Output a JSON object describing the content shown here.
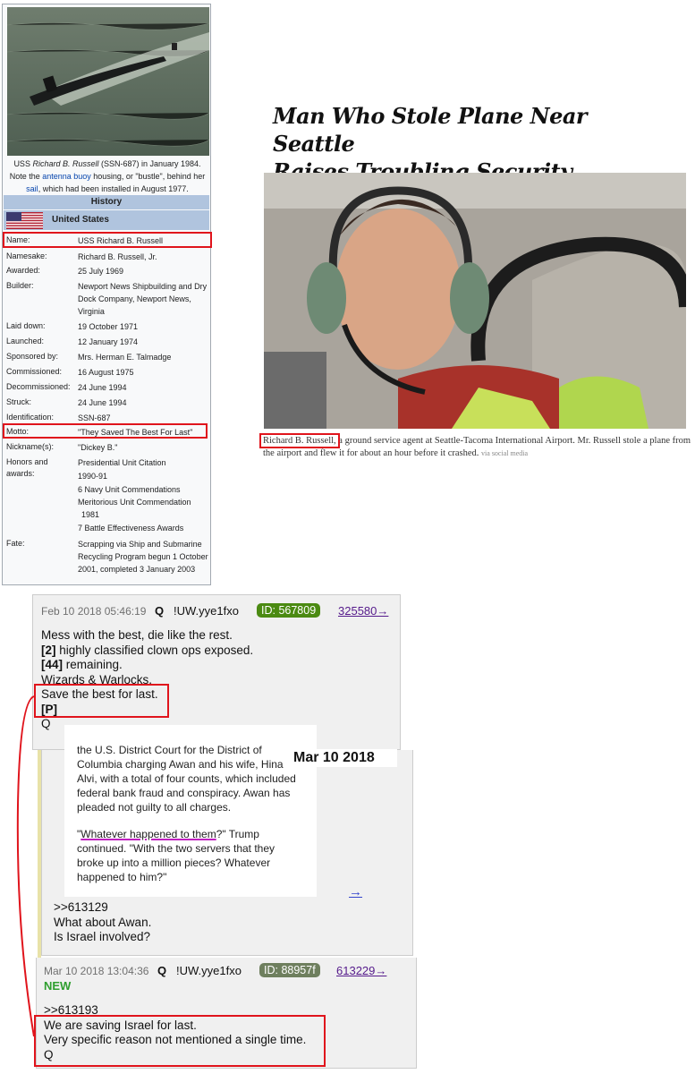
{
  "wiki": {
    "photo_caption_prefix": "USS ",
    "photo_caption_italic": "Richard B. Russell",
    "photo_caption_rest": " (SSN-687) in January 1984.",
    "photo_note_1": "Note the ",
    "photo_note_link1": "antenna buoy",
    "photo_note_2": " housing, or \"bustle\", behind her",
    "photo_note_link2": "sail",
    "photo_note_3": ", which had been installed in August 1977.",
    "history_header": "History",
    "country": "United States",
    "fields": [
      {
        "label": "Name:",
        "value": "USS Richard B. Russell"
      },
      {
        "label": "Namesake:",
        "value": "Richard B. Russell, Jr."
      },
      {
        "label": "Awarded:",
        "value": "25 July 1969"
      },
      {
        "label": "Builder:",
        "value": "Newport News Shipbuilding and Dry Dock Company, Newport News, Virginia"
      },
      {
        "label": "Laid down:",
        "value": "19 October 1971"
      },
      {
        "label": "Launched:",
        "value": "12 January 1974"
      },
      {
        "label": "Sponsored by:",
        "value": "Mrs. Herman E. Talmadge"
      },
      {
        "label": "Commissioned:",
        "value": "16 August 1975"
      },
      {
        "label": "Decommissioned:",
        "value": "24 June 1994"
      },
      {
        "label": "Struck:",
        "value": "24 June 1994"
      },
      {
        "label": "Identification:",
        "value": "SSN-687"
      },
      {
        "label": "Motto:",
        "value": "\"They Saved The Best For Last\""
      },
      {
        "label": "Nickname(s):",
        "value": "\"Dickey B.\""
      },
      {
        "label": "Honors and awards:",
        "value": ""
      },
      {
        "label": "Fate:",
        "value": ""
      }
    ],
    "honors": [
      "Presidential Unit Citation",
      "1990-91",
      "6 Navy Unit Commendations",
      "Meritorious Unit Commendation",
      "1981",
      "7 Battle Effectiveness Awards"
    ],
    "fate": "Scrapping via Ship and Submarine Recycling Program begun 1 October 2001, completed 3 January 2003"
  },
  "nyt": {
    "headline_line1": "Man Who Stole Plane Near Seattle",
    "headline_line2": "Raises Troubling Security Questions",
    "caption_name": "Richard B. Russell",
    "caption_rest": ", a ground service agent at Seattle-Tacoma International Airport. Mr. Russell stole a plane from the airport and flew it for about an hour before it crashed.",
    "caption_credit": "via social media"
  },
  "post1": {
    "date": "Feb 10 2018 05:46:19",
    "name": "Q",
    "trip": "!UW.yye1fxo",
    "id": "ID: 567809",
    "id_color": "#4b8a12",
    "post_no": "325580→",
    "line1": "Mess with the best, die like the rest.",
    "line2_bold": "[2]",
    "line2": " highly classified clown ops exposed.",
    "line3_bold": "[44]",
    "line3": " remaining.",
    "line4": "Wizards & Warlocks.",
    "line5": "Save the best for last.",
    "line6": "[P]",
    "line7": "Q"
  },
  "post2": {
    "date_overlay": "Mar 10 2018",
    "quote_l1": "the U.S. District Court for the District of",
    "quote_l2": "Columbia charging Awan and his wife, Hina",
    "quote_l3": "Alvi, with a total of four counts, which included",
    "quote_l4": "federal bank fraud and conspiracy. Awan has",
    "quote_l5": "pleaded not guilty to all charges.",
    "quote_l6a": "\"",
    "quote_l6u": "Whatever happened to them",
    "quote_l6b": "?\" Trump",
    "quote_l7": "continued. \"With the two servers that they",
    "quote_l8": "broke up into a million pieces? Whatever",
    "quote_l9": "happened to him?\"",
    "arrow": "→",
    "reply_ref": ">>613129",
    "reply_l1": "What about Awan.",
    "reply_l2": "Is Israel involved?"
  },
  "post3": {
    "date": "Mar 10 2018 13:04:36",
    "name": "Q",
    "trip": "!UW.yye1fxo",
    "id": "ID: 88957f",
    "id_color": "#6e7f5e",
    "post_no": "613229→",
    "new_label": "NEW",
    "ref": ">>613193",
    "line1": "We are saving Israel for last.",
    "line2": "Very specific reason not mentioned a single time.",
    "line3": "Q"
  },
  "colors": {
    "highlight_red": "#e0141c",
    "new_green": "#2e9e2e",
    "underline_purple": "#c020c0"
  }
}
